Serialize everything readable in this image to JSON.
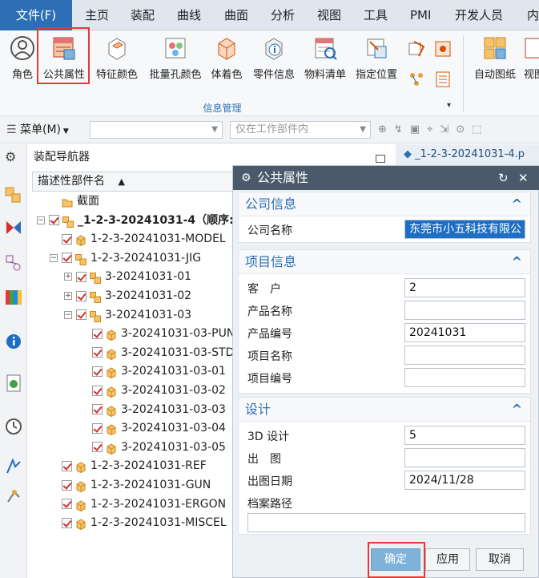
{
  "menubar": {
    "items": [
      "文件(F)",
      "主页",
      "装配",
      "曲线",
      "曲面",
      "分析",
      "视图",
      "工具",
      "PMI",
      "开发人员",
      "内"
    ]
  },
  "ribbon": {
    "buttons": [
      {
        "label": "角色",
        "icon": "user-circle-icon"
      },
      {
        "label": "公共属性",
        "icon": "attributes-table-icon"
      },
      {
        "label": "特征颜色",
        "icon": "feature-color-icon"
      },
      {
        "label": "批量孔颜色",
        "icon": "hole-color-icon"
      },
      {
        "label": "体着色",
        "icon": "body-shading-icon"
      },
      {
        "label": "零件信息",
        "icon": "part-info-icon"
      },
      {
        "label": "物料清单",
        "icon": "bom-icon"
      },
      {
        "label": "指定位置",
        "icon": "locate-icon"
      },
      {
        "label": "自动图纸",
        "icon": "auto-drawing-icon"
      },
      {
        "label": "视图",
        "icon": "view-icon"
      }
    ],
    "group_label": "信息管理",
    "group_caret": "▾"
  },
  "toolbar": {
    "menu_label": "菜单(M)",
    "filter_placeholder": "",
    "scope_value": "仅在工作部件内"
  },
  "navigator": {
    "title": "装配导航器",
    "column_header": "描述性部件名",
    "sort_glyph": "▲",
    "rows": [
      {
        "text": "截面",
        "indent": 1,
        "kind": "folder",
        "check": false,
        "exp": ""
      },
      {
        "text": "_1-2-3-20241031-4（顺序:",
        "indent": 0,
        "kind": "assy",
        "check": true,
        "exp": "−",
        "bold": true
      },
      {
        "text": "1-2-3-20241031-MODEL",
        "indent": 1,
        "kind": "part",
        "check": true,
        "exp": ""
      },
      {
        "text": "1-2-3-20241031-JIG",
        "indent": 1,
        "kind": "assy",
        "check": true,
        "exp": "−"
      },
      {
        "text": "3-20241031-01",
        "indent": 2,
        "kind": "assy",
        "check": true,
        "exp": "+"
      },
      {
        "text": "3-20241031-02",
        "indent": 2,
        "kind": "assy",
        "check": true,
        "exp": "+"
      },
      {
        "text": "3-20241031-03",
        "indent": 2,
        "kind": "assy",
        "check": true,
        "exp": "−"
      },
      {
        "text": "3-20241031-03-PUN",
        "indent": 3,
        "kind": "part",
        "check": true,
        "exp": ""
      },
      {
        "text": "3-20241031-03-STD",
        "indent": 3,
        "kind": "part",
        "check": true,
        "exp": ""
      },
      {
        "text": "3-20241031-03-01",
        "indent": 3,
        "kind": "part",
        "check": true,
        "exp": ""
      },
      {
        "text": "3-20241031-03-02",
        "indent": 3,
        "kind": "part",
        "check": true,
        "exp": ""
      },
      {
        "text": "3-20241031-03-03",
        "indent": 3,
        "kind": "part",
        "check": true,
        "exp": ""
      },
      {
        "text": "3-20241031-03-04",
        "indent": 3,
        "kind": "part",
        "check": true,
        "exp": ""
      },
      {
        "text": "3-20241031-03-05",
        "indent": 3,
        "kind": "part",
        "check": true,
        "exp": ""
      },
      {
        "text": "1-2-3-20241031-REF",
        "indent": 1,
        "kind": "part",
        "check": true,
        "exp": ""
      },
      {
        "text": "1-2-3-20241031-GUN",
        "indent": 1,
        "kind": "part",
        "check": true,
        "exp": ""
      },
      {
        "text": "1-2-3-20241031-ERGON",
        "indent": 1,
        "kind": "part",
        "check": true,
        "exp": ""
      },
      {
        "text": "1-2-3-20241031-MISCEL",
        "indent": 1,
        "kind": "part",
        "check": true,
        "exp": ""
      }
    ]
  },
  "graphics_tab": {
    "title": "_1-2-3-20241031-4.p"
  },
  "dialog": {
    "title": "公共属性",
    "reset_glyph": "↻",
    "close_glyph": "✕",
    "collapse_glyph": "^",
    "sections": {
      "company": {
        "title": "公司信息",
        "fields": [
          {
            "label": "公司名称",
            "value": "东莞市小五科技有限公"
          }
        ]
      },
      "project": {
        "title": "项目信息",
        "fields": [
          {
            "label": "客　户",
            "value": "2"
          },
          {
            "label": "产品名称",
            "value": ""
          },
          {
            "label": "产品编号",
            "value": "20241031"
          },
          {
            "label": "项目名称",
            "value": ""
          },
          {
            "label": "项目编号",
            "value": ""
          }
        ]
      },
      "design": {
        "title": "设计",
        "fields": [
          {
            "label": "3D 设计",
            "value": "5"
          },
          {
            "label": "出　图",
            "value": ""
          },
          {
            "label": "出图日期",
            "value": "2024/11/28"
          }
        ],
        "archive_label": "档案路径",
        "archive_value": ""
      }
    },
    "buttons": {
      "ok": "确定",
      "apply": "应用",
      "cancel": "取消"
    }
  },
  "colors": {
    "accent": "#2d6fb4",
    "dialog_title_bg": "#4b5a6b",
    "highlight_red": "#e53935",
    "ok_button": "#7fb2d8"
  }
}
